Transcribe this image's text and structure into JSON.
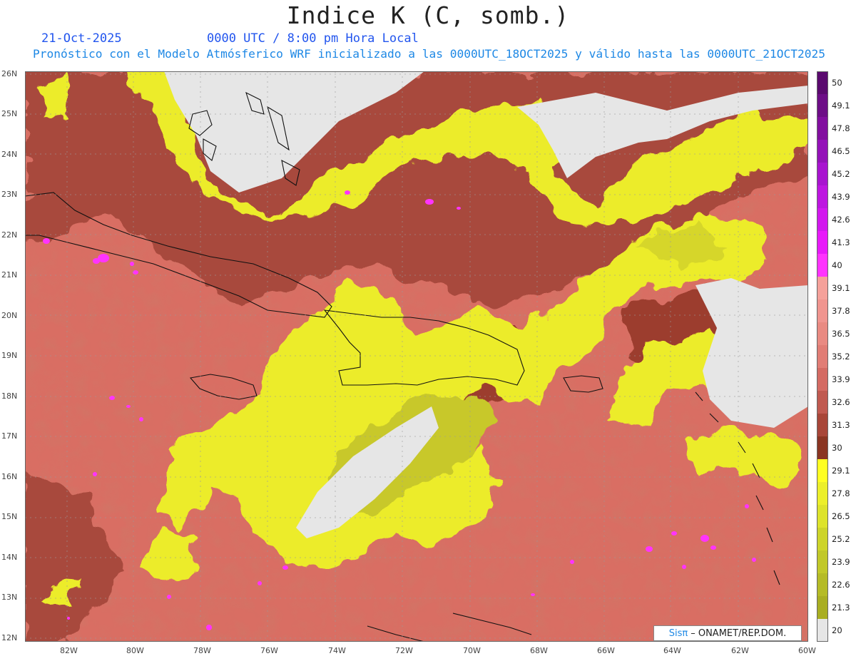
{
  "header": {
    "title": "Indice K (C, somb.)",
    "date": "21-Oct-2025",
    "time": "0000 UTC / 8:00 pm Hora Local",
    "description": "Pronóstico con el Modelo Atmósferico WRF inicializado a las 0000UTC_18OCT2025 y válido hasta las  0000UTC_21OCT2025"
  },
  "map": {
    "lat_labels": [
      "26N",
      "25N",
      "24N",
      "23N",
      "22N",
      "21N",
      "20N",
      "19N",
      "18N",
      "17N",
      "16N",
      "15N",
      "14N",
      "13N",
      "12N"
    ],
    "lon_labels": [
      "82W",
      "80W",
      "78W",
      "76W",
      "74W",
      "72W",
      "70W",
      "68W",
      "66W",
      "64W",
      "62W",
      "60W"
    ]
  },
  "colorbar": {
    "labels": [
      "50",
      "49.1",
      "47.8",
      "46.5",
      "45.2",
      "43.9",
      "42.6",
      "41.3",
      "40",
      "39.1",
      "37.8",
      "36.5",
      "35.2",
      "33.9",
      "32.6",
      "31.3",
      "30",
      "29.1",
      "27.8",
      "26.5",
      "25.2",
      "23.9",
      "22.6",
      "21.3",
      "20"
    ],
    "colors": [
      "#5a0a6e",
      "#6d0e86",
      "#820f9f",
      "#9412b8",
      "#a814cf",
      "#bd16e0",
      "#d218ee",
      "#e81afa",
      "#ff33ff",
      "#f5a19a",
      "#f0958f",
      "#e98a82",
      "#e17d75",
      "#d46b63",
      "#c05a50",
      "#a84638",
      "#8a3522",
      "#ffff22",
      "#ecef2a",
      "#dde32b",
      "#cdd42a",
      "#c1c829",
      "#b5bb26",
      "#a9ae22",
      "#e6e6e6"
    ]
  },
  "credit": {
    "sis": "Sisπ",
    "org": "– ONAMET/REP.DOM."
  }
}
